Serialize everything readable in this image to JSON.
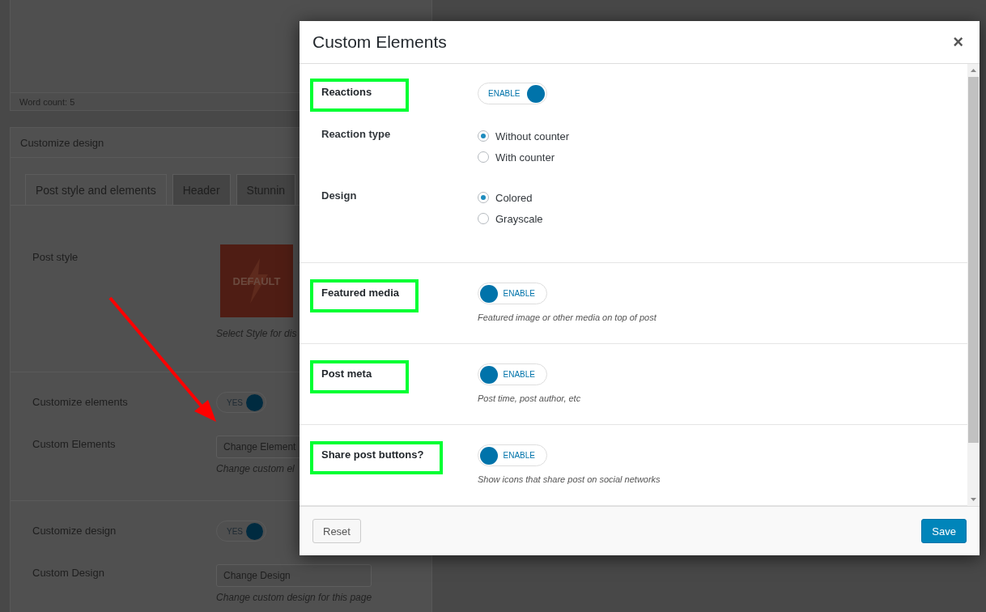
{
  "page": {
    "word_count": "Word count: 5",
    "box_title": "Customize design",
    "tabs": [
      {
        "label": "Post style and elements",
        "selected": true
      },
      {
        "label": "Header",
        "selected": false
      },
      {
        "label": "Stunnin",
        "selected": false
      }
    ],
    "post_style": {
      "label": "Post style",
      "thumbnail": "DEFAULT",
      "caption": "Select Style for dis"
    },
    "groups": [
      {
        "rows": [
          {
            "kind": "toggle",
            "label": "Customize elements",
            "toggle": "YES",
            "on": true
          },
          {
            "kind": "button",
            "label": "Custom Elements",
            "button": "Change Element",
            "caption": "Change custom el"
          }
        ]
      },
      {
        "rows": [
          {
            "kind": "toggle",
            "label": "Customize design",
            "toggle": "YES",
            "on": true
          },
          {
            "kind": "button",
            "label": "Custom Design",
            "button": "Change Design",
            "caption": "Change custom design for this page"
          }
        ]
      }
    ]
  },
  "modal": {
    "title": "Custom Elements",
    "close": "×",
    "sections": [
      {
        "label": "Reactions",
        "highlighted": true,
        "toggle": {
          "label": "ENABLE",
          "on": true
        },
        "options": [
          {
            "label": "Reaction type",
            "choices": [
              {
                "label": "Without counter",
                "selected": true
              },
              {
                "label": "With counter",
                "selected": false
              }
            ]
          },
          {
            "label": "Design",
            "choices": [
              {
                "label": "Colored",
                "selected": true
              },
              {
                "label": "Grayscale",
                "selected": false
              }
            ]
          }
        ]
      },
      {
        "label": "Featured media",
        "highlighted": true,
        "toggle": {
          "label": "ENABLE",
          "on": false
        },
        "hint": "Featured image or other media on top of post"
      },
      {
        "label": "Post meta",
        "highlighted": true,
        "toggle": {
          "label": "ENABLE",
          "on": false
        },
        "hint": "Post time, post author, etc"
      },
      {
        "label": "Share post buttons?",
        "highlighted": true,
        "toggle": {
          "label": "ENABLE",
          "on": false
        },
        "hint": "Show icons that share post on social networks"
      }
    ],
    "buttons": [
      {
        "label": "Reset",
        "kind": "secondary"
      },
      {
        "label": "Save",
        "kind": "primary"
      }
    ]
  }
}
